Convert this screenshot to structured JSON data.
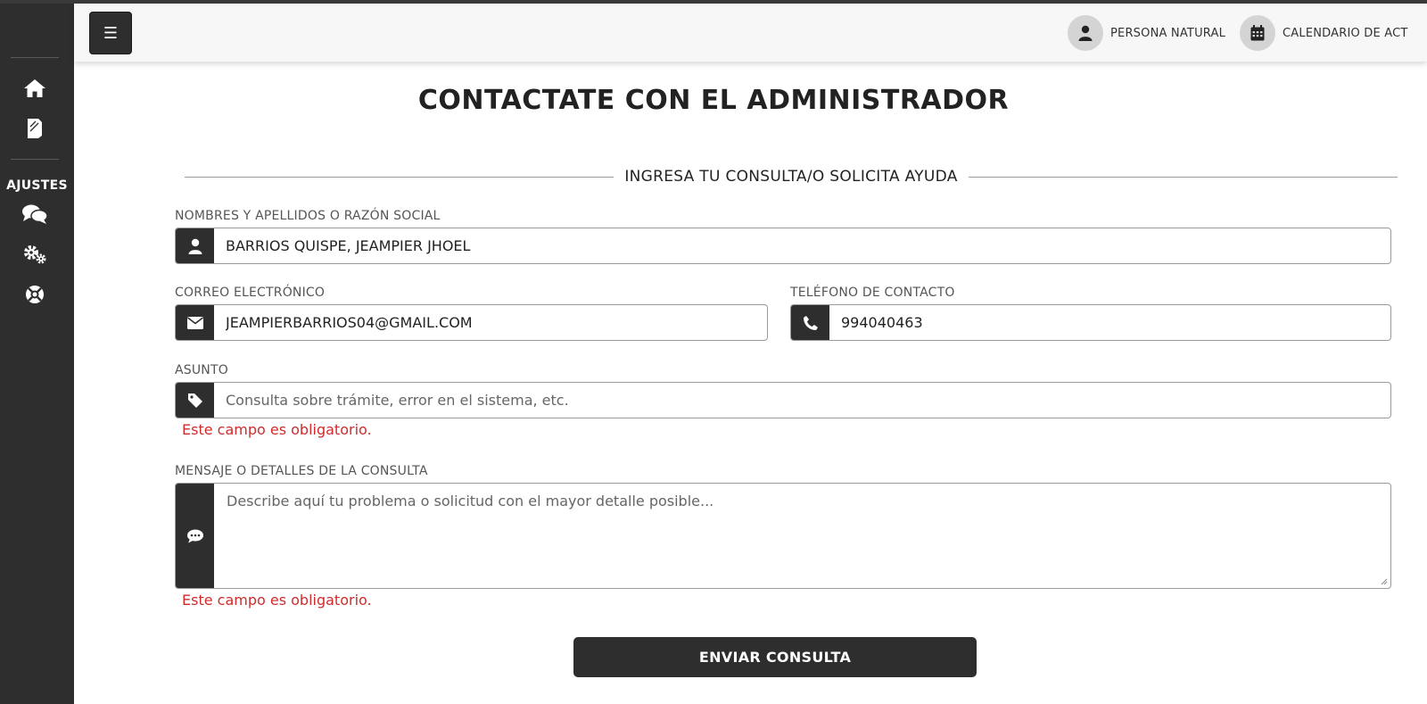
{
  "header": {
    "menu_label": "☰",
    "user_type": "PERSONA NATURAL",
    "calendar": "CALENDARIO DE ACT"
  },
  "sidebar": {
    "section_label": "AJUSTES",
    "icons": [
      "home-icon",
      "document-icon",
      "chat-icon",
      "gears-icon",
      "lifebuoy-icon"
    ]
  },
  "main": {
    "title": "CONTACTATE CON EL ADMINISTRADOR",
    "legend": "INGRESA TU CONSULTA/O SOLICITA AYUDA",
    "fields": {
      "name": {
        "label": "NOMBRES Y APELLIDOS O RAZÓN SOCIAL",
        "value": "BARRIOS QUISPE, JEAMPIER JHOEL"
      },
      "email": {
        "label": "CORREO ELECTRÓNICO",
        "value": "JEAMPIERBARRIOS04@GMAIL.COM"
      },
      "phone": {
        "label": "TELÉFONO DE CONTACTO",
        "value": "994040463"
      },
      "subject": {
        "label": "ASUNTO",
        "value": "",
        "placeholder": "Consulta sobre trámite, error en el sistema, etc.",
        "error": "Este campo es obligatorio."
      },
      "message": {
        "label": "MENSAJE O DETALLES DE LA CONSULTA",
        "value": "",
        "placeholder": "Describe aquí tu problema o solicitud con el mayor detalle posible...",
        "error": "Este campo es obligatorio."
      }
    },
    "submit_label": "ENVIAR CONSULTA"
  },
  "colors": {
    "sidebar_bg": "#2e2e2e",
    "error": "#d12b2b",
    "header_bg": "#f7f7f7"
  }
}
